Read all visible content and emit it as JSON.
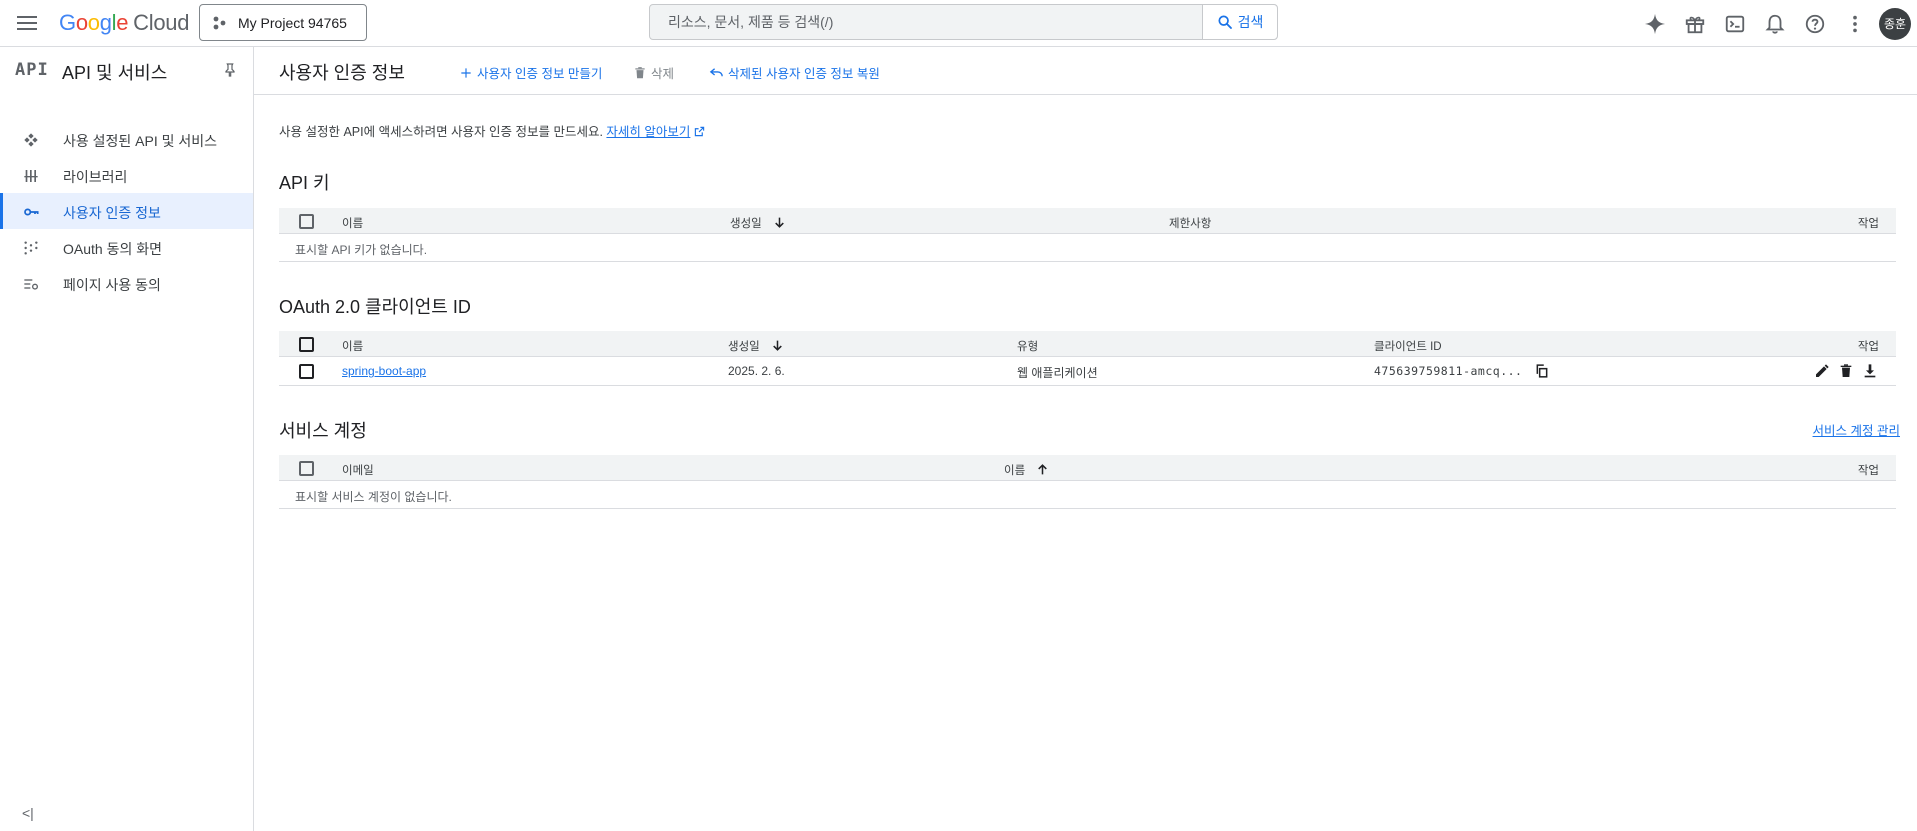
{
  "topbar": {
    "logo_word": "Google",
    "logo_suffix": "Cloud",
    "project_name": "My Project 94765",
    "search_placeholder": "리소스, 문서, 제품 등 검색(/)",
    "search_button": "검색",
    "avatar_initials": "종훈",
    "icons": [
      "gemini-icon",
      "gift-icon",
      "terminal-icon",
      "bell-icon",
      "help-icon",
      "more-icon"
    ]
  },
  "sidebar": {
    "badge": "API",
    "title": "API 및 서비스",
    "items": [
      {
        "label": "사용 설정된 API 및 서비스",
        "icon": "diamond-icon"
      },
      {
        "label": "라이브러리",
        "icon": "library-icon"
      },
      {
        "label": "사용자 인증 정보",
        "icon": "key-icon"
      },
      {
        "label": "OAuth 동의 화면",
        "icon": "oauth-icon"
      },
      {
        "label": "페이지 사용 동의",
        "icon": "settings-list-icon"
      }
    ],
    "collapse": "<|"
  },
  "header": {
    "title": "사용자 인증 정보",
    "create": "사용자 인증 정보 만들기",
    "delete": "삭제",
    "restore": "삭제된 사용자 인증 정보 복원"
  },
  "intro": {
    "text": "사용 설정한 API에 액세스하려면 사용자 인증 정보를 만드세요.",
    "link": "자세히 알아보기"
  },
  "api_keys": {
    "title": "API 키",
    "columns": {
      "name": "이름",
      "created": "생성일",
      "restrictions": "제한사항",
      "actions": "작업"
    },
    "empty": "표시할 API 키가 없습니다."
  },
  "oauth": {
    "title": "OAuth 2.0 클라이언트 ID",
    "columns": {
      "name": "이름",
      "created": "생성일",
      "type": "유형",
      "client_id": "클라이언트 ID",
      "actions": "작업"
    },
    "rows": [
      {
        "name": "spring-boot-app",
        "created": "2025. 2. 6.",
        "type": "웹 애플리케이션",
        "client_id": "475639759811-amcq..."
      }
    ]
  },
  "service_accounts": {
    "title": "서비스 계정",
    "manage": "서비스 계정 관리",
    "columns": {
      "email": "이메일",
      "name": "이름",
      "actions": "작업"
    },
    "empty": "표시할 서비스 계정이 없습니다."
  }
}
